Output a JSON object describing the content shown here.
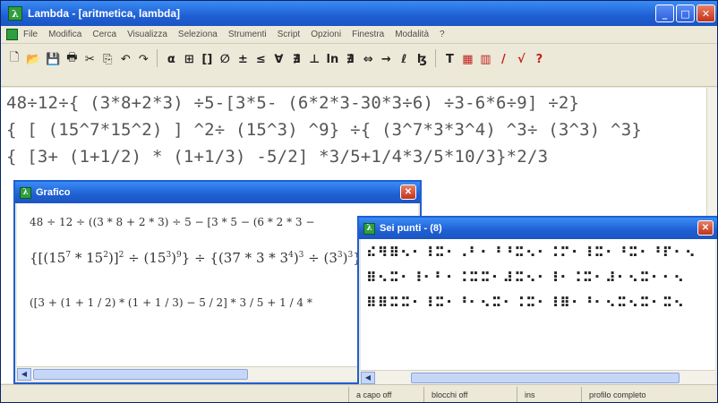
{
  "window": {
    "title": "Lambda - [aritmetica, lambda]",
    "icon": "lambda-app-icon",
    "minimize_icon": "minimize-icon",
    "maximize_icon": "maximize-icon",
    "close_icon": "close-icon"
  },
  "menu": {
    "items": [
      "File",
      "Modifica",
      "Cerca",
      "Visualizza",
      "Seleziona",
      "Strumenti",
      "Script",
      "Opzioni",
      "Finestra",
      "Modalità",
      "?"
    ]
  },
  "toolbar": {
    "buttons": [
      {
        "name": "new-doc-button",
        "glyph": "🗋"
      },
      {
        "name": "open-button",
        "glyph": "📂"
      },
      {
        "name": "save-button",
        "glyph": "💾"
      },
      {
        "name": "print-button",
        "glyph": "🖶"
      },
      {
        "name": "cut-button",
        "glyph": "✂"
      },
      {
        "name": "copy-button",
        "glyph": "⎘"
      },
      {
        "name": "undo-button",
        "glyph": "↶"
      },
      {
        "name": "redo-button",
        "glyph": "↷"
      },
      {
        "name": "sep",
        "glyph": ""
      },
      {
        "name": "fraction-button",
        "glyph": "α"
      },
      {
        "name": "matrix-button",
        "glyph": "⊞"
      },
      {
        "name": "brackets-button",
        "glyph": "[]"
      },
      {
        "name": "emptyset-button",
        "glyph": "∅"
      },
      {
        "name": "plusminus-button",
        "glyph": "±"
      },
      {
        "name": "leq-button",
        "glyph": "≤"
      },
      {
        "name": "forall-button",
        "glyph": "∀"
      },
      {
        "name": "integral-button",
        "glyph": "∄"
      },
      {
        "name": "perp-button",
        "glyph": "⊥"
      },
      {
        "name": "log-button",
        "glyph": "ln"
      },
      {
        "name": "limit-button",
        "glyph": "∄"
      },
      {
        "name": "iff-button",
        "glyph": "⇔"
      },
      {
        "name": "arrow-button",
        "glyph": "→"
      },
      {
        "name": "lowercase-button",
        "glyph": "ℓ"
      },
      {
        "name": "bold-button",
        "glyph": "ɮ"
      },
      {
        "name": "sep",
        "glyph": ""
      },
      {
        "name": "text-button",
        "glyph": "T"
      },
      {
        "name": "red-matrix-button",
        "glyph": "▦"
      },
      {
        "name": "red-matrix2-button",
        "glyph": "▥"
      },
      {
        "name": "slash-button",
        "glyph": "/"
      },
      {
        "name": "root-button",
        "glyph": "√"
      },
      {
        "name": "help-button",
        "glyph": "?"
      }
    ]
  },
  "editor": {
    "lines": [
      "48÷12÷{ (3*8+2*3) ÷5-[3*5- (6*2*3-30*3÷6) ÷3-6*6÷9] ÷2}",
      "{ [ (15^7*15^2) ] ^2÷ (15^3) ^9} ÷{ (3^7*3*3^4) ^3÷ (3^3) ^3}",
      "{ [3+ (1+1/2) * (1+1/3) -5/2] *3/5+1/4*3/5*10/3}*2/3"
    ]
  },
  "grafico": {
    "title": "Grafico",
    "line1": "48 ÷ 12 ÷ ((3 * 8 + 2 * 3) ÷ 5 − [3 * 5 − (6 * 2 * 3 −",
    "line2_parts": [
      "{[(15",
      "7",
      " * 15",
      "2",
      ")]",
      "2",
      " ÷ (15",
      "3",
      ")",
      "9",
      "} ÷ {(3",
      "7",
      " * 3 * 3",
      "4",
      ")",
      "3",
      " ÷ (3",
      "3",
      ")",
      "3",
      "}"
    ],
    "line3": "([3 + (1 + 1 / 2) * (1 + 1 / 3) − 5 / 2] * 3 / 5 + 1 / 4 *"
  },
  "braille_window": {
    "title": "Sei punti - (8)",
    "rows": [
      "⠮⠻⠿⠢⠂⠸⠭⠂⠠⠃⠂⠘⠘⠭⠢⠂⠨⠍⠂⠸⠭⠂⠘⠭⠂⠘⠏⠂⠢",
      "⠿⠢⠭⠂⠸⠂⠃⠂⠨⠭⠭⠂⠼⠭⠢⠂⠸⠂⠨⠭⠂⠼⠂⠢⠭⠂⠂⠢",
      "⠿⠿⠭⠭⠂⠸⠭⠂⠘⠂⠢⠭⠂⠨⠭⠂⠸⠿⠂⠘⠂⠢⠭⠢⠭⠂⠭⠢"
    ]
  },
  "status": {
    "cells": [
      "",
      "a capo off",
      "blocchi off",
      "ins",
      "profilo completo"
    ]
  }
}
